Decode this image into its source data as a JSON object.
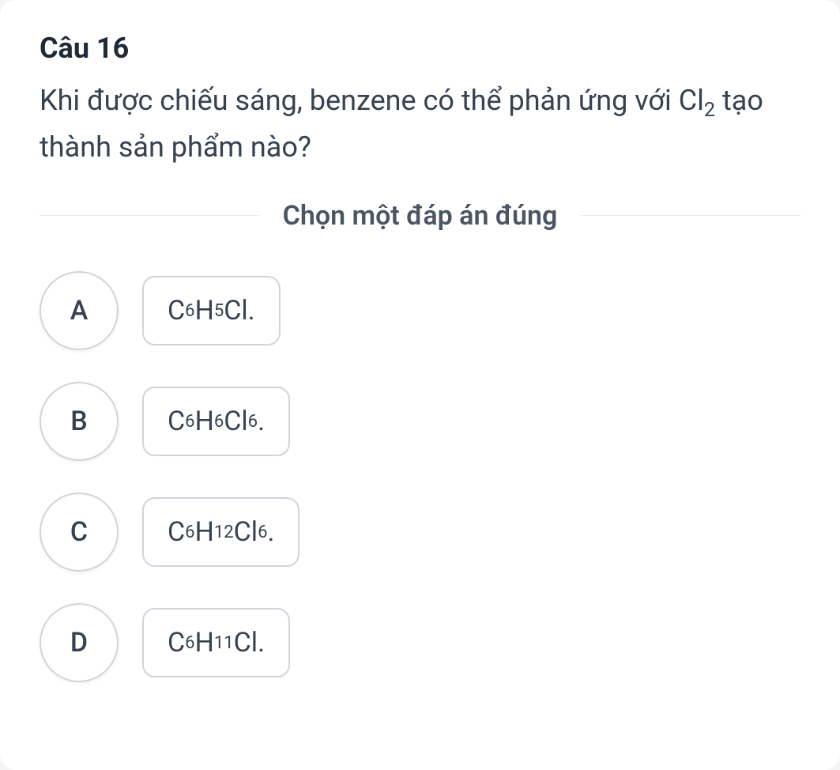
{
  "question": {
    "number": "Câu 16",
    "text_parts": {
      "p1": "Khi được chiếu sáng, benzene có thể phản ứng với Cl",
      "sub1": "2",
      "p2": " tạo thành sản phẩm nào?"
    }
  },
  "instruction": "Chọn một đáp án đúng",
  "options": [
    {
      "letter": "A",
      "formula": [
        {
          "t": "C"
        },
        {
          "s": "6"
        },
        {
          "t": "H"
        },
        {
          "s": "5"
        },
        {
          "t": "Cl."
        }
      ]
    },
    {
      "letter": "B",
      "formula": [
        {
          "t": "C"
        },
        {
          "s": "6"
        },
        {
          "t": "H"
        },
        {
          "s": "6"
        },
        {
          "t": "Cl"
        },
        {
          "s": "6"
        },
        {
          "t": "."
        }
      ]
    },
    {
      "letter": "C",
      "formula": [
        {
          "t": "C"
        },
        {
          "s": "6"
        },
        {
          "t": "H"
        },
        {
          "s": "12"
        },
        {
          "t": "Cl"
        },
        {
          "s": "6"
        },
        {
          "t": "."
        }
      ]
    },
    {
      "letter": "D",
      "formula": [
        {
          "t": "C"
        },
        {
          "s": "6"
        },
        {
          "t": "H"
        },
        {
          "s": "11"
        },
        {
          "t": "Cl."
        }
      ]
    }
  ]
}
